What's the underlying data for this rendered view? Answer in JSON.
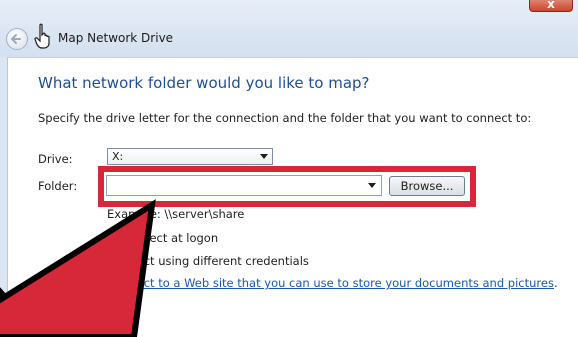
{
  "window": {
    "close_label": "x",
    "dialog_title": "Map Network Drive"
  },
  "main": {
    "heading": "What network folder would you like to map?",
    "instruction": "Specify the drive letter for the connection and the folder that you want to connect to:",
    "drive_label": "Drive:",
    "drive_value": "X:",
    "folder_label": "Folder:",
    "folder_value": "",
    "browse_label": "Browse...",
    "example_text": "Example: \\\\server\\share",
    "reconnect_label": "Reconnect at logon",
    "credentials_label": "Connect using different credentials",
    "link_text": "Connect to a Web site that you can use to store your documents and pictures",
    "link_suffix": "."
  },
  "colors": {
    "heading": "#1e4f95",
    "highlight": "#d7283a",
    "arrow_fill": "#d7283a",
    "link": "#1b56b0"
  },
  "icons": {
    "back": "back-arrow-icon",
    "cursor": "hand-pointer-icon",
    "dropdown": "chevron-down-icon"
  }
}
